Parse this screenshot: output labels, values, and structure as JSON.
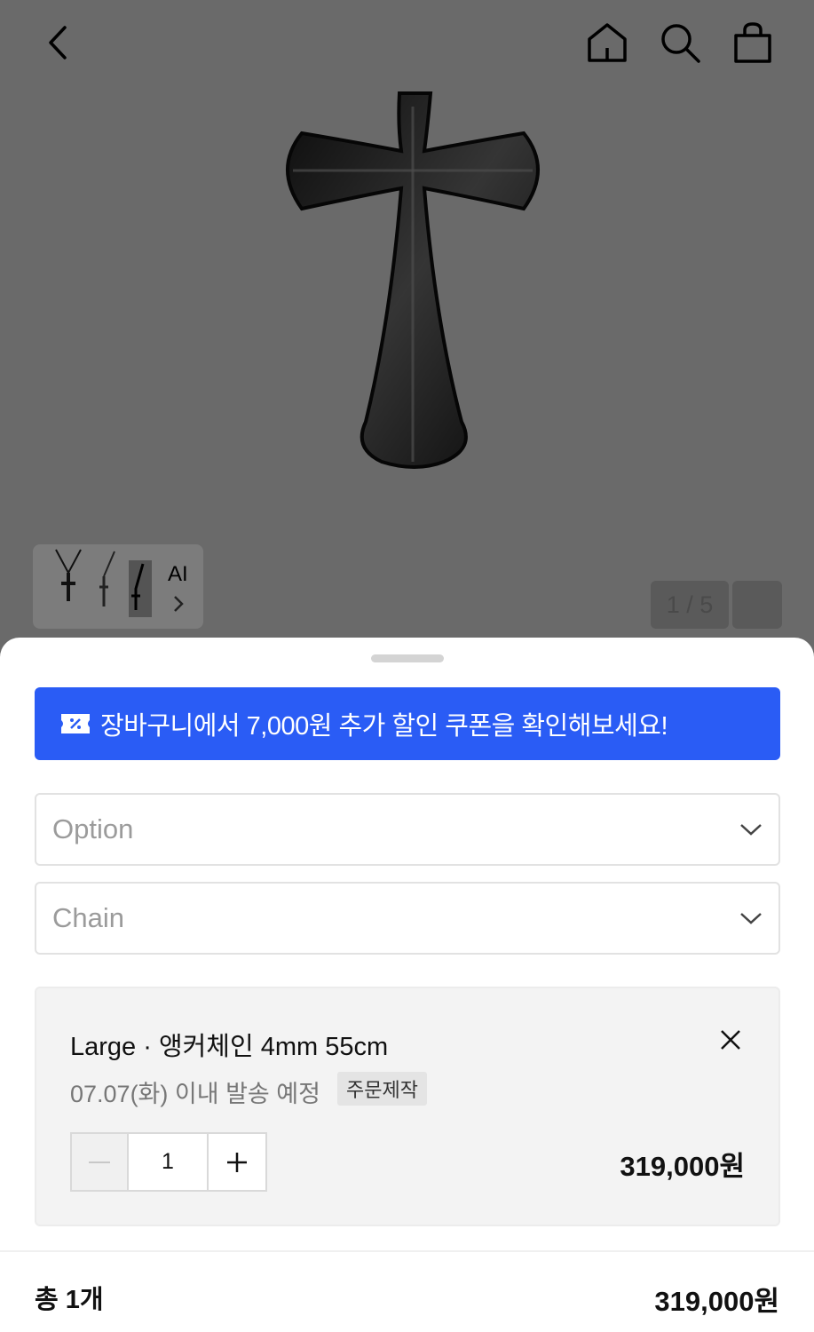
{
  "header": {
    "back_icon": "chevron-left-icon",
    "home_icon": "home-icon",
    "search_icon": "search-icon",
    "cart_icon": "shopping-bag-icon"
  },
  "gallery": {
    "ai_label": "AI",
    "counter": "1 / 5"
  },
  "coupon_banner": {
    "text": "장바구니에서 7,000원 추가 할인 쿠폰을 확인해보세요!",
    "icon": "coupon-icon",
    "color": "#2a5cf5"
  },
  "selects": [
    {
      "placeholder": "Option"
    },
    {
      "placeholder": "Chain"
    }
  ],
  "selected_item": {
    "name": "Large · 앵커체인 4mm 55cm",
    "shipping": "07.07(화) 이내 발송 예정",
    "badge": "주문제작",
    "quantity": "1",
    "price": "319,000원"
  },
  "summary": {
    "total_label": "총 1개",
    "total_price": "319,000원"
  }
}
